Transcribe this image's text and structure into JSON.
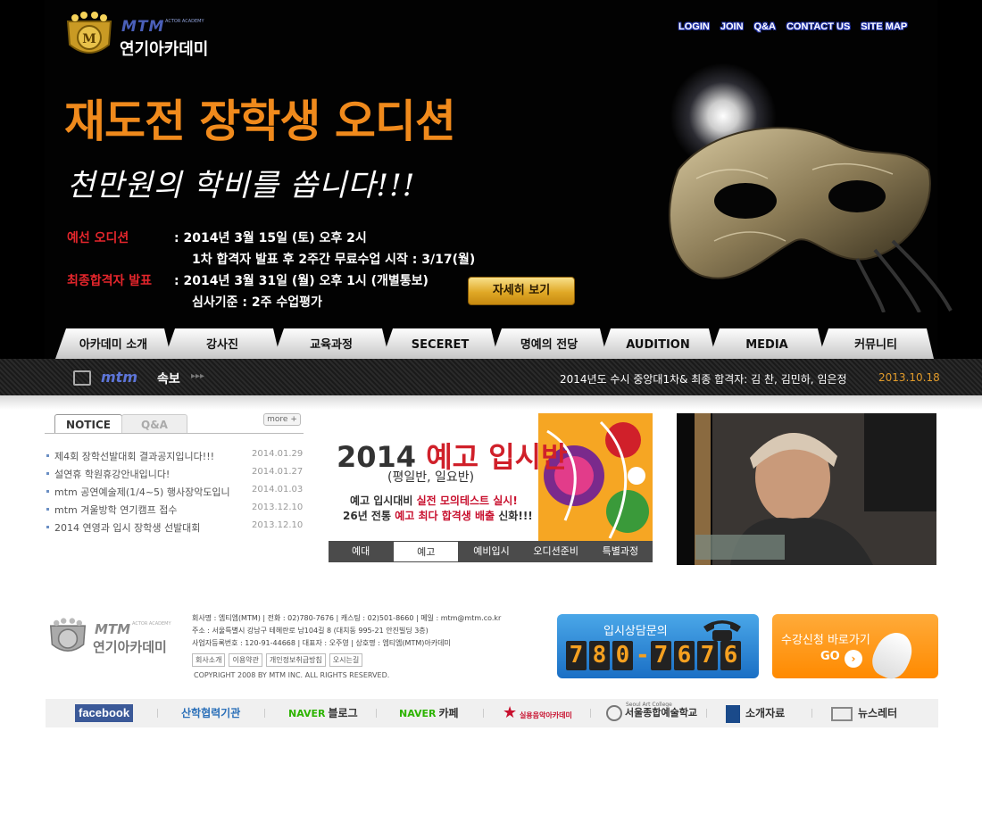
{
  "header": {
    "logo_brand": "MTM",
    "logo_sub": "ACTOR ACADEMY",
    "logo_name": "연기아카데미",
    "top_links": [
      "LOGIN",
      "JOIN",
      "Q&A",
      "CONTACT US",
      "SITE MAP"
    ]
  },
  "hero": {
    "title": "재도전 장학생 오디션",
    "subtitle": "천만원의 학비를 쏩니다!!!",
    "row1_label": "예선 오디션",
    "row1_value": ":  2014년 3월 15일 (토) 오후 2시",
    "row2_value": "1차 합격자 발표 후 2주간 무료수업 시작 : 3/17(월)",
    "row3_label": "최종합격자 발표",
    "row3_value": ":  2014년 3월 31일 (월) 오후 1시 (개별통보)",
    "row4_value": "심사기준 : 2주 수업평가",
    "detail_button": "자세히 보기"
  },
  "main_nav": [
    "아카데미 소개",
    "강사진",
    "교육과정",
    "SECERET",
    "명예의 전당",
    "AUDITION",
    "MEDIA",
    "커뮤니티"
  ],
  "news": {
    "brand": "mtm",
    "label": "속보",
    "arrows": "▸▸▸",
    "text": "2014년도 수시 중앙대1차& 최종 합격자: 김 찬, 김민하, 임은정",
    "date": "2013.10.18"
  },
  "notice": {
    "tab_notice": "NOTICE",
    "tab_qa": "Q&A",
    "more": "more +",
    "items": [
      {
        "title": "제4회 장학선발대회 결과공지입니다!!!",
        "date": "2014.01.29"
      },
      {
        "title": "설연휴 학원휴강안내입니다!",
        "date": "2014.01.27"
      },
      {
        "title": "mtm 공연예술제(1/4~5) 행사장악도입니",
        "date": "2014.01.03"
      },
      {
        "title": "mtm 겨울방학 연기캠프 접수",
        "date": "2013.12.10"
      },
      {
        "title": "2014 연영과 입시 장학생 선발대회",
        "date": "2013.12.10"
      }
    ]
  },
  "banner": {
    "year": "2014",
    "title": "예고 입시반",
    "sub": "(평일반, 일요반)",
    "line1_a": "예고 입시대비 ",
    "line1_b": "실전 모의테스트 실시!",
    "line2_a": "26년 전통 ",
    "line2_b": "예고 최다 합격생 배출",
    "line2_c": " 신화!!!",
    "tabs": [
      "예대",
      "예고",
      "예비입시",
      "오디션준비",
      "특별과정"
    ],
    "active_tab": "예고"
  },
  "footer": {
    "logo_brand": "MTM",
    "logo_sub": "ACTOR ACADEMY",
    "logo_name": "연기아카데미",
    "info1": "회사명 : 엠티엠(MTM) | 전화 : 02)780-7676 | 캐스팅 : 02)501-8660 | 메일 : mtm@mtm.co.kr",
    "info2": "주소 : 서울특별시 강남구 테헤란로 남104길 8 (대치동 995-21 안진빌딩 3층)",
    "info3": "사업자등록번호 : 120-91-44668 | 대표자 : 오주영 | 상호명 : 엠티엠(MTM)아카데미",
    "links": [
      "회사소개",
      "이용약관",
      "개인정보취급방침",
      "오시는길"
    ],
    "copyright": "COPYRIGHT 2008 BY MTM INC. ALL RIGHTS RESERVED.",
    "phone_label": "입시상담문의",
    "phone_digits": [
      "7",
      "8",
      "0",
      "-",
      "7",
      "6",
      "7",
      "6"
    ],
    "apply_label": "수강신청 바로가기",
    "apply_go": "GO"
  },
  "partners": {
    "facebook": "facebook",
    "industry": "산학협력기관",
    "naver": "NAVER",
    "blog": "블로그",
    "cafe": "카페",
    "mtm_academy": "실용음악아카데미",
    "college_small": "Seoul Art College",
    "college": "서울종합예술학교",
    "brochure": "소개자료",
    "newsletter": "뉴스레터"
  }
}
